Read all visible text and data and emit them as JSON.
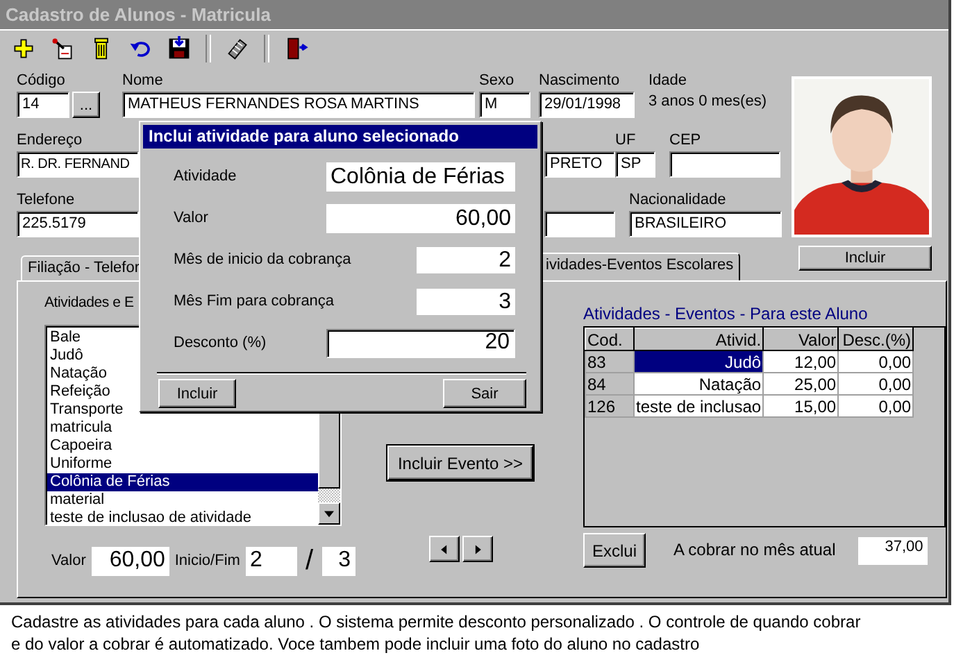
{
  "window": {
    "title": "Cadastro de Alunos - Matricula"
  },
  "student": {
    "codigo": {
      "label": "Código",
      "value": "14"
    },
    "lookup_button": "...",
    "nome": {
      "label": "Nome",
      "value": "MATHEUS FERNANDES ROSA MARTINS"
    },
    "sexo": {
      "label": "Sexo",
      "value": "M"
    },
    "nascimento": {
      "label": "Nascimento",
      "value": "29/01/1998"
    },
    "idade": {
      "label": "Idade",
      "value": "3 anos 0 mes(es)"
    },
    "endereco": {
      "label": "Endereço",
      "value": "R. DR. FERNAND"
    },
    "cidade": {
      "value": "PRETO"
    },
    "uf": {
      "label": "UF",
      "value": "SP"
    },
    "cep": {
      "label": "CEP"
    },
    "telefone": {
      "label": "Telefone",
      "value": "225.5179"
    },
    "nacionalidade": {
      "label": "Nacionalidade",
      "value": "BRASILEIRO"
    }
  },
  "photo": {
    "kind": "picture",
    "button": "Incluir"
  },
  "tabs": [
    {
      "label": "Filiação - Telefor",
      "selected": false
    },
    {
      "label": "ividades-Eventos Escolares",
      "selected": true
    }
  ],
  "activities": {
    "label": "Atividades e E",
    "items": [
      {
        "label": "Bale",
        "selected": false
      },
      {
        "label": "Judô",
        "selected": false
      },
      {
        "label": "Natação",
        "selected": false
      },
      {
        "label": "Refeição",
        "selected": false
      },
      {
        "label": "Transporte",
        "selected": false
      },
      {
        "label": "matricula",
        "selected": false
      },
      {
        "label": "Capoeira",
        "selected": false
      },
      {
        "label": "Uniforme",
        "selected": false
      },
      {
        "label": "Colônia de Férias",
        "selected": true
      },
      {
        "label": "material",
        "selected": false
      },
      {
        "label": "teste de inclusao de atividade",
        "selected": false
      }
    ],
    "include_button": "Incluir Evento >>",
    "valor_label": "Valor",
    "valor": "60,00",
    "inicio_fim_label": "Inicio/Fim",
    "inicio": "2",
    "separator": "/",
    "fim": "3"
  },
  "events": {
    "title": "Atividades - Eventos - Para este Aluno",
    "columns": [
      "Cod.",
      "Ativid.",
      "Valor",
      "Desc.(%)"
    ],
    "rows": [
      {
        "cells": [
          "83",
          "Judô",
          "12,00",
          "0,00"
        ],
        "selected": true
      },
      {
        "cells": [
          "84",
          "Natação",
          "25,00",
          "0,00"
        ],
        "selected": false
      },
      {
        "cells": [
          "126",
          "teste de inclusao",
          "15,00",
          "0,00"
        ],
        "selected": false
      }
    ],
    "delete_button": "Exclui",
    "total_label": "A cobrar no mês atual",
    "total": "37,00"
  },
  "dialog": {
    "title": "Inclui atividade para aluno selecionado",
    "fields": [
      {
        "label": "Atividade",
        "value": "Colônia de Férias",
        "kind": "wide"
      },
      {
        "label": "Valor",
        "value": "60,00",
        "kind": "wide"
      },
      {
        "label": "Mês de inicio da cobrança",
        "value": "2",
        "kind": "short"
      },
      {
        "label": "Mês Fim para cobrança",
        "value": "3",
        "kind": "short"
      },
      {
        "label": "Desconto (%)",
        "value": "20",
        "kind": "sunken"
      }
    ],
    "buttons": [
      "Incluir",
      "Sair"
    ]
  },
  "caption": "Cadastre as atividades para cada aluno . O sistema permite desconto personalizado . O controle de quando cobrar\n e do valor a cobrar é automatizado. Voce tambem pode incluir uma foto do aluno no cadastro"
}
